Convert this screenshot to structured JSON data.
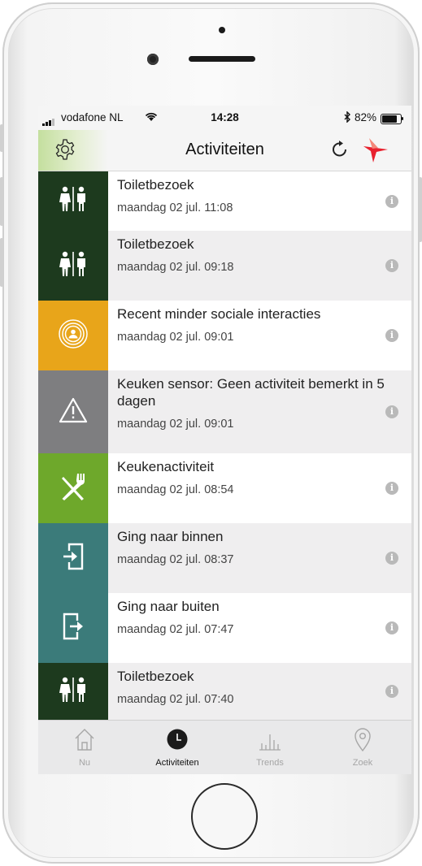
{
  "status_bar": {
    "carrier": "vodafone NL",
    "time": "14:28",
    "battery": "82%"
  },
  "nav": {
    "title": "Activiteiten"
  },
  "activities": [
    {
      "title": "Toiletbezoek",
      "time": "maandag 02 jul. 11:08",
      "icon": "toilet-icon",
      "color": "#1d3a1e"
    },
    {
      "title": "Toiletbezoek",
      "time": "maandag 02 jul. 09:18",
      "icon": "toilet-icon",
      "color": "#1d3a1e"
    },
    {
      "title": "Recent minder sociale interacties",
      "time": "maandag 02 jul. 09:01",
      "icon": "social-interaction-icon",
      "color": "#e8a51a"
    },
    {
      "title": "Keuken sensor: Geen activiteit bemerkt in 5 dagen",
      "time": "maandag 02 jul. 09:01",
      "icon": "warning-icon",
      "color": "#7e7e80"
    },
    {
      "title": "Keukenactiviteit",
      "time": "maandag 02 jul. 08:54",
      "icon": "kitchen-icon",
      "color": "#6ea82b"
    },
    {
      "title": "Ging naar binnen",
      "time": "maandag 02 jul. 08:37",
      "icon": "enter-icon",
      "color": "#3b7b7a"
    },
    {
      "title": "Ging naar buiten",
      "time": "maandag 02 jul. 07:47",
      "icon": "exit-icon",
      "color": "#3b7b7a"
    },
    {
      "title": "Toiletbezoek",
      "time": "maandag 02 jul. 07:40",
      "icon": "toilet-icon",
      "color": "#1d3a1e"
    }
  ],
  "tabs": [
    {
      "label": "Nu",
      "icon": "home-icon"
    },
    {
      "label": "Activiteiten",
      "icon": "clock-icon"
    },
    {
      "label": "Trends",
      "icon": "bar-chart-icon"
    },
    {
      "label": "Zoek",
      "icon": "location-pin-icon"
    }
  ],
  "colors": {
    "accent": "#e8212e",
    "settings_gradient": "#c4df9e"
  }
}
